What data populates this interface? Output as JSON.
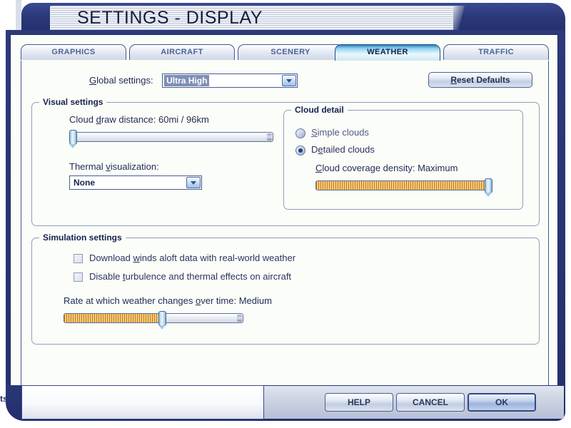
{
  "window": {
    "title": "SETTINGS - DISPLAY"
  },
  "background": {
    "clipped_text": "ts"
  },
  "tabs": [
    {
      "label": "GRAPHICS",
      "active": false
    },
    {
      "label": "AIRCRAFT",
      "active": false
    },
    {
      "label": "SCENERY",
      "active": false
    },
    {
      "label": "WEATHER",
      "active": true
    },
    {
      "label": "TRAFFIC",
      "active": false
    }
  ],
  "toolbar": {
    "global_settings_label": "Global settings:",
    "global_settings_value": "Ultra High",
    "reset_defaults_label": "Reset Defaults"
  },
  "visual_settings": {
    "group_title": "Visual settings",
    "cloud_draw_distance": {
      "label": "Cloud draw distance: 60mi / 96km",
      "value": "60mi / 96km",
      "percent": 0
    },
    "thermal_visualization": {
      "label": "Thermal visualization:",
      "value": "None"
    }
  },
  "cloud_detail": {
    "group_title": "Cloud detail",
    "options": [
      {
        "label": "Simple clouds",
        "selected": false
      },
      {
        "label": "Detailed clouds",
        "selected": true
      }
    ],
    "coverage_density": {
      "label": "Cloud coverage density: Maximum",
      "value": "Maximum",
      "percent": 100
    }
  },
  "simulation_settings": {
    "group_title": "Simulation settings",
    "checkboxes": [
      {
        "label": "Download winds aloft data with real-world weather",
        "checked": false
      },
      {
        "label": "Disable turbulence and thermal effects on aircraft",
        "checked": false
      }
    ],
    "weather_rate": {
      "label": "Rate at which weather changes over time: Medium",
      "value": "Medium",
      "percent": 55
    }
  },
  "footer": {
    "help_label": "HELP",
    "cancel_label": "CANCEL",
    "ok_label": "OK"
  },
  "colors": {
    "frame_navy": "#2b3878",
    "panel_bg": "#fbfdf8",
    "accent_orange": "#c67b13",
    "active_tab_cyan": "#8fd4ef",
    "text_navy": "#1f2a57"
  }
}
